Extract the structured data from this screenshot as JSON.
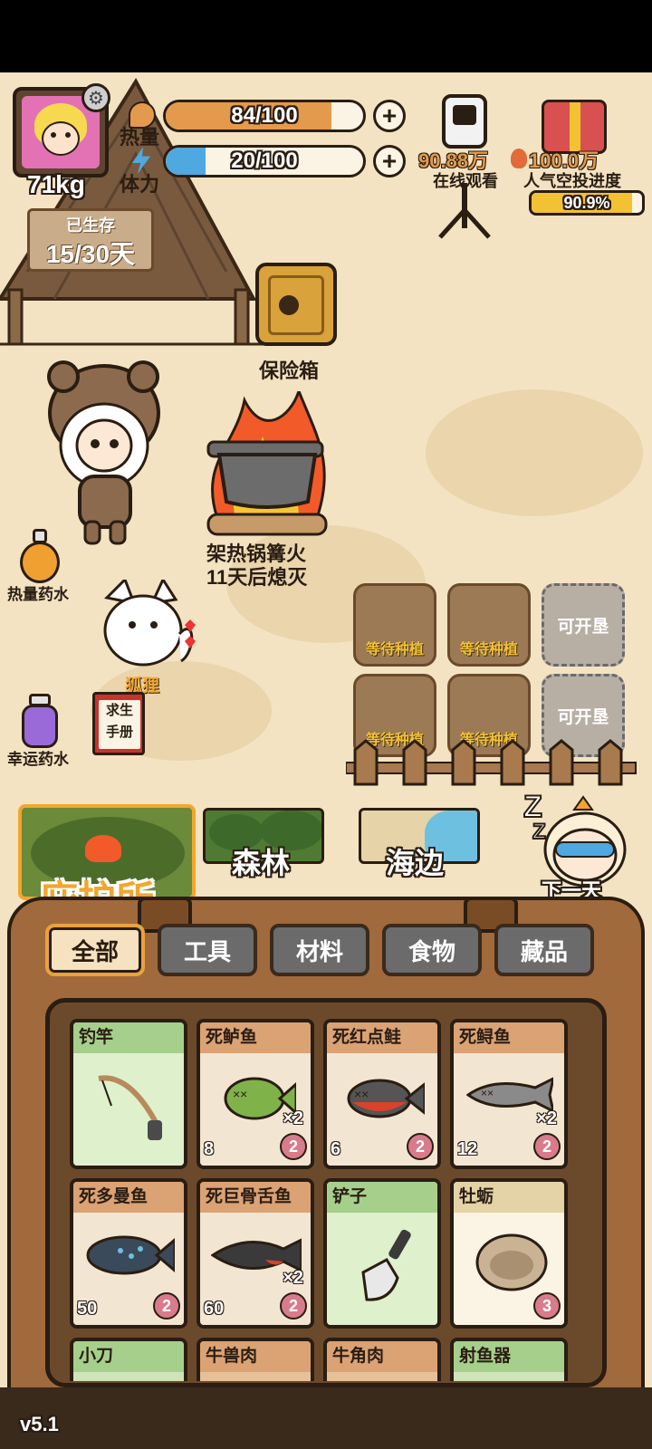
{
  "player": {
    "weight": "71kg",
    "survived_label": "已生存",
    "survived_value": "15/30天"
  },
  "stats": {
    "calorie_label": "热量",
    "calorie_text": "84/100",
    "calorie_level": 0.84,
    "stamina_label": "体力",
    "stamina_text": "20/100",
    "stamina_level": 0.2
  },
  "live": {
    "viewers": "90.88万",
    "viewers_label": "在线观看",
    "popularity": "100.0万",
    "popularity_label": "人气空投进度",
    "progress_text": "90.9%",
    "progress_level": 0.909
  },
  "scene": {
    "safe_label": "保险箱",
    "fire_label": "架热锅篝火",
    "fire_timer": "11天后熄灭",
    "calorie_potion": "热量药水",
    "fox_label": "狐狸",
    "luck_potion": "幸运药水",
    "manual_label_1": "求生",
    "manual_label_2": "手册"
  },
  "plots": [
    {
      "label": "等待种植"
    },
    {
      "label": "等待种植"
    },
    {
      "label": "可开垦"
    },
    {
      "label": "等待种植"
    },
    {
      "label": "等待种植"
    },
    {
      "label": "可开垦"
    }
  ],
  "locations": {
    "shelter": "庇护所",
    "forest": "森林",
    "beach": "海边",
    "next_day": "下一天"
  },
  "tabs": [
    "全部",
    "工具",
    "材料",
    "食物",
    "藏品"
  ],
  "items": [
    {
      "name": "钓竿",
      "type": "tool"
    },
    {
      "name": "死鲈鱼",
      "calories": "8",
      "count": "2",
      "mult": "×2",
      "type": "food"
    },
    {
      "name": "死红点鲑",
      "calories": "6",
      "count": "2",
      "type": "food"
    },
    {
      "name": "死鲟鱼",
      "calories": "12",
      "count": "2",
      "mult": "×2",
      "type": "food"
    },
    {
      "name": "死多曼鱼",
      "calories": "50",
      "count": "2",
      "type": "food"
    },
    {
      "name": "死巨骨舌鱼",
      "calories": "60",
      "count": "2",
      "mult": "×2",
      "type": "food"
    },
    {
      "name": "铲子",
      "type": "tool"
    },
    {
      "name": "牡蛎",
      "count": "3",
      "type": "collect"
    },
    {
      "name": "小刀",
      "type": "tool"
    },
    {
      "name": "牛兽肉",
      "type": "food"
    },
    {
      "name": "牛角肉",
      "type": "food"
    },
    {
      "name": "射鱼器",
      "type": "tool"
    }
  ],
  "version": "v5.1",
  "colors": {
    "calorie_bar": "#e39a4c",
    "stamina_bar": "#4fa8e0",
    "tool_card": "#cfe4b8",
    "food_card": "#e6c097",
    "collect_card": "#efe3c2",
    "badge_pink": "#d97b8c"
  }
}
